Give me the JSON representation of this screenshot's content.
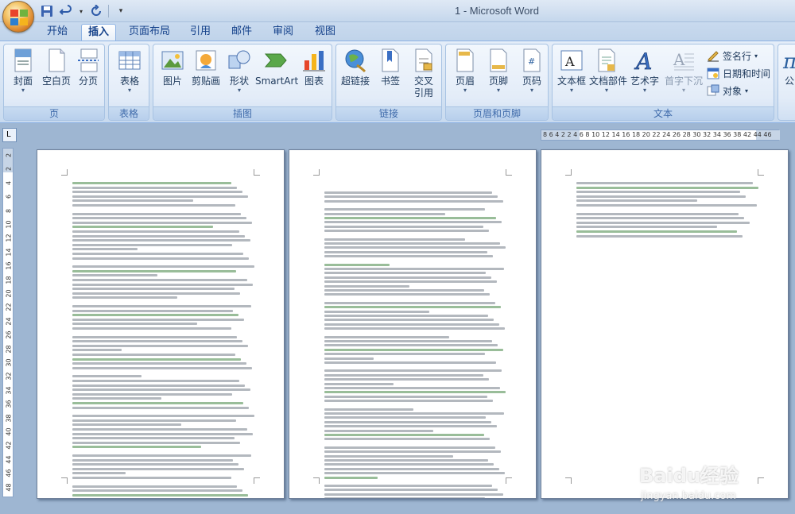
{
  "window": {
    "title": "1 - Microsoft Word"
  },
  "tabs": [
    {
      "label": "开始",
      "active": false
    },
    {
      "label": "插入",
      "active": true
    },
    {
      "label": "页面布局",
      "active": false
    },
    {
      "label": "引用",
      "active": false
    },
    {
      "label": "邮件",
      "active": false
    },
    {
      "label": "审阅",
      "active": false
    },
    {
      "label": "视图",
      "active": false
    }
  ],
  "groups": {
    "pages": {
      "label": "页",
      "items": [
        "封面",
        "空白页",
        "分页"
      ]
    },
    "tables": {
      "label": "表格",
      "items": [
        "表格"
      ]
    },
    "illustrations": {
      "label": "插图",
      "items": [
        "图片",
        "剪贴画",
        "形状",
        "SmartArt",
        "图表"
      ]
    },
    "links": {
      "label": "链接",
      "items": [
        "超链接",
        "书签",
        "交叉",
        "引用"
      ]
    },
    "header_footer": {
      "label": "页眉和页脚",
      "items": [
        "页眉",
        "页脚",
        "页码"
      ]
    },
    "text": {
      "label": "文本",
      "items": [
        "文本框",
        "文档部件",
        "艺术字",
        "首字下沉"
      ],
      "small": [
        "签名行",
        "日期和时间",
        "对象"
      ]
    },
    "symbols": {
      "partial": "公"
    }
  },
  "ruler": {
    "horizontal": "8 6 4 2   2 4 6 8 10 12 14 16 18 20 22 24 26 28 30 32 34 36 38   42 44 46",
    "corner": "L",
    "vertical": [
      "2",
      "2",
      "4",
      "6",
      "8",
      "10",
      "12",
      "14",
      "16",
      "18",
      "20",
      "22",
      "24",
      "26",
      "28",
      "30",
      "32",
      "34",
      "36",
      "38",
      "40",
      "42",
      "44",
      "46",
      "48"
    ]
  },
  "watermark": {
    "brand": "Baidu经验",
    "url": "jingyan.baidu.com"
  },
  "colors": {
    "ribbon_bg": "#d5e3f3",
    "workspace": "#9eb6d2",
    "tab_text": "#15428b"
  }
}
